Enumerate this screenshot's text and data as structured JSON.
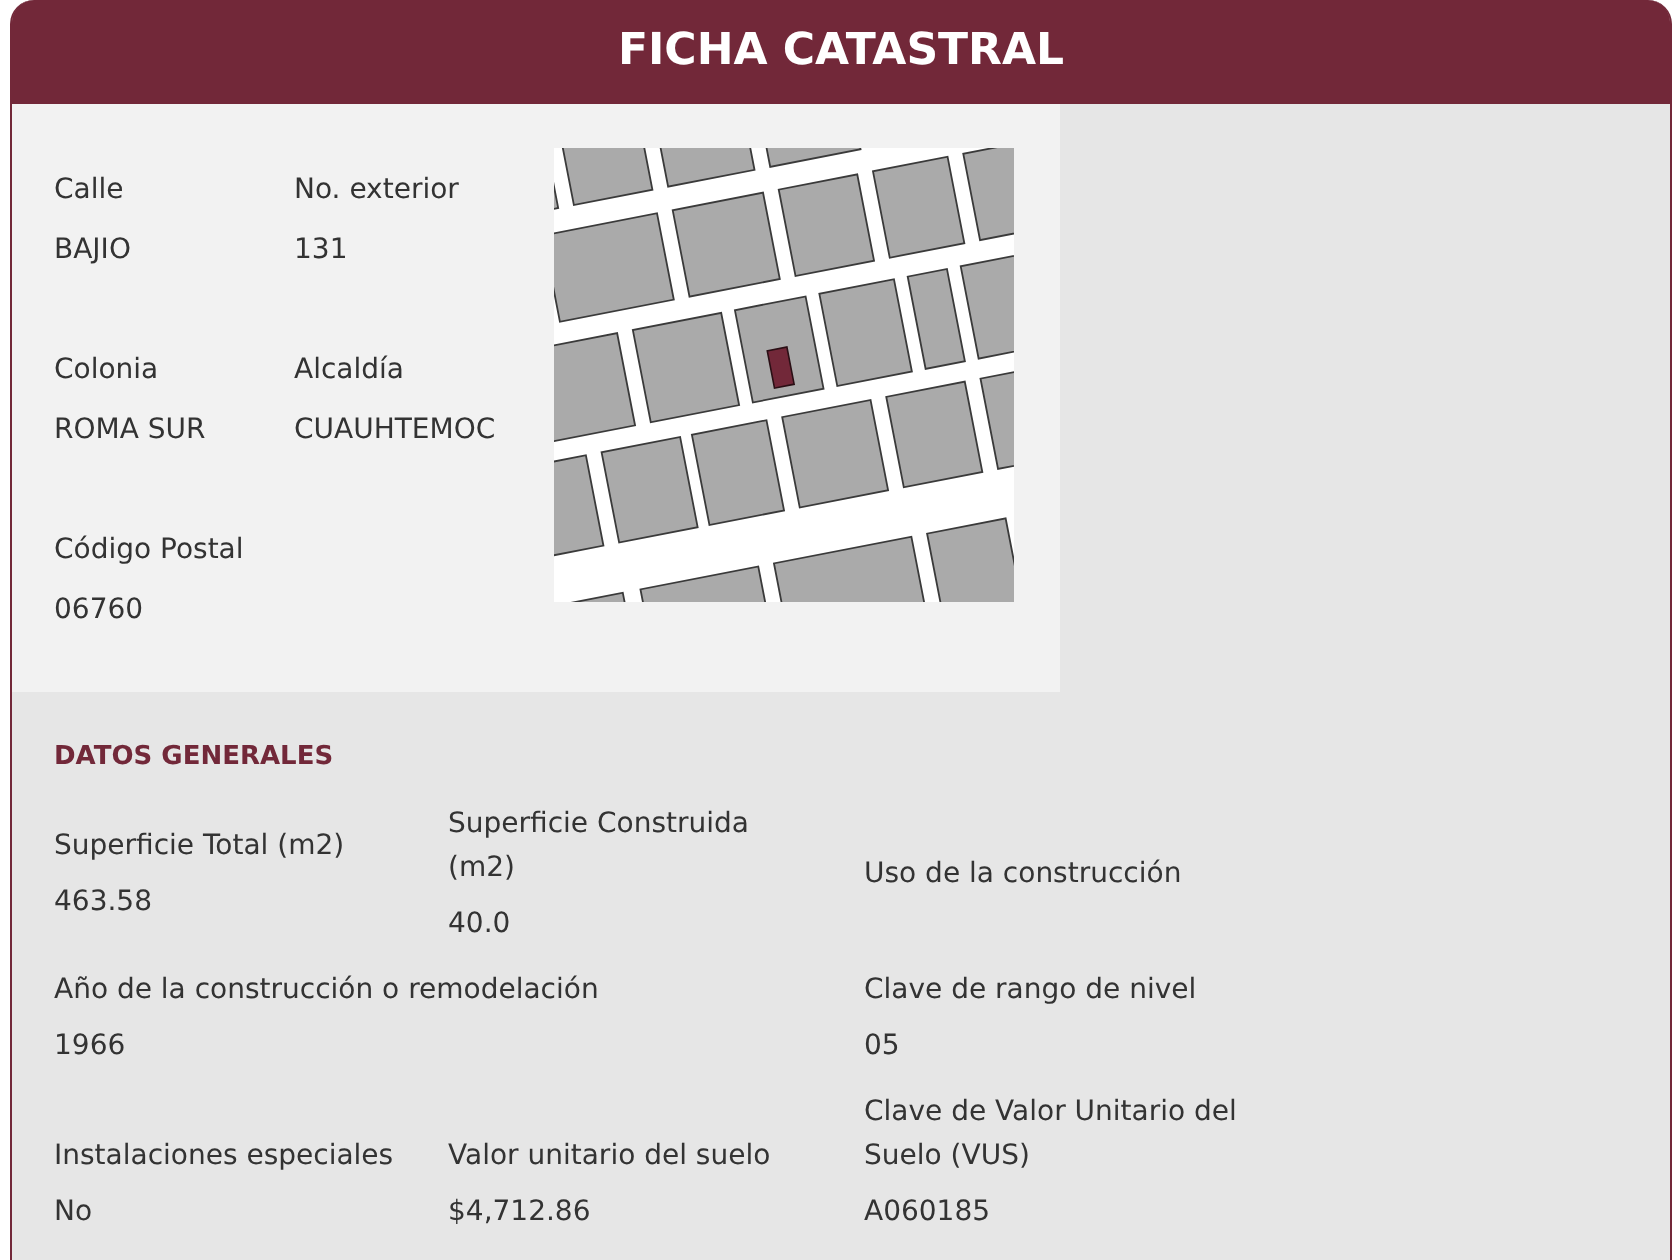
{
  "header": {
    "title": "FICHA CATASTRAL"
  },
  "location": {
    "rows": [
      [
        {
          "label": "Calle",
          "value": "BAJIO"
        },
        {
          "label": "No. exterior",
          "value": "131"
        }
      ],
      [
        {
          "label": "Colonia",
          "value": "ROMA SUR"
        },
        {
          "label": "Alcaldía",
          "value": "CUAUHTEMOC"
        }
      ],
      [
        {
          "label": "Código Postal",
          "value": "06760"
        }
      ]
    ]
  },
  "general": {
    "title": "DATOS GENERALES",
    "rows": [
      [
        {
          "label": "Superficie Total (m2)",
          "value": "463.58"
        },
        {
          "label": "Superficie Construida (m2)",
          "value": "40.0"
        },
        {
          "label": "Uso de la construcción"
        }
      ],
      [
        {
          "label": "Año de la construcción o remodelación",
          "value": "1966"
        },
        null,
        {
          "label": "Clave de rango de nivel",
          "value": "05"
        }
      ],
      [
        {
          "label": "Instalaciones especiales",
          "value": "No"
        },
        {
          "label": "Valor unitario del suelo",
          "value": "$4,712.86"
        },
        {
          "label": "Clave de Valor Unitario del Suelo (VUS)",
          "value": "A060185"
        }
      ]
    ]
  }
}
